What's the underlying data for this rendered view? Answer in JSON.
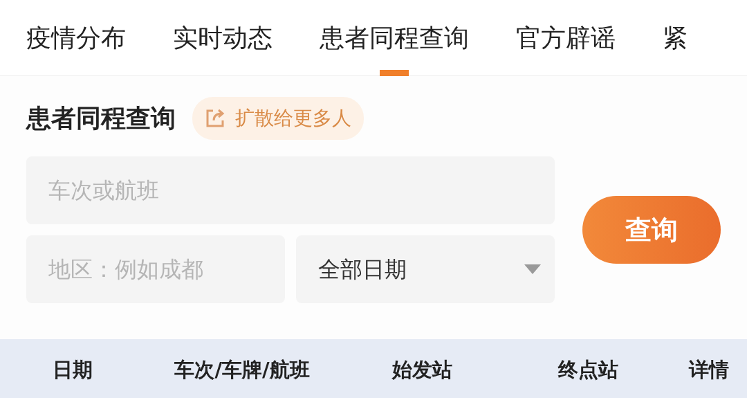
{
  "tabs": [
    {
      "label": "疫情分布",
      "selected": false
    },
    {
      "label": "实时动态",
      "selected": false
    },
    {
      "label": "患者同程查询",
      "selected": true
    },
    {
      "label": "官方辟谣",
      "selected": false
    },
    {
      "label": "紧",
      "selected": false
    }
  ],
  "section": {
    "title": "患者同程查询",
    "share_button": "扩散给更多人"
  },
  "form": {
    "trip_field": {
      "placeholder": "车次或航班"
    },
    "region_field": {
      "placeholder": "地区：例如成都"
    },
    "date_select": {
      "value": "全部日期"
    },
    "search_button": "查询"
  },
  "table": {
    "columns": [
      "日期",
      "车次/车牌/航班",
      "始发站",
      "终点站",
      "详情"
    ]
  }
}
